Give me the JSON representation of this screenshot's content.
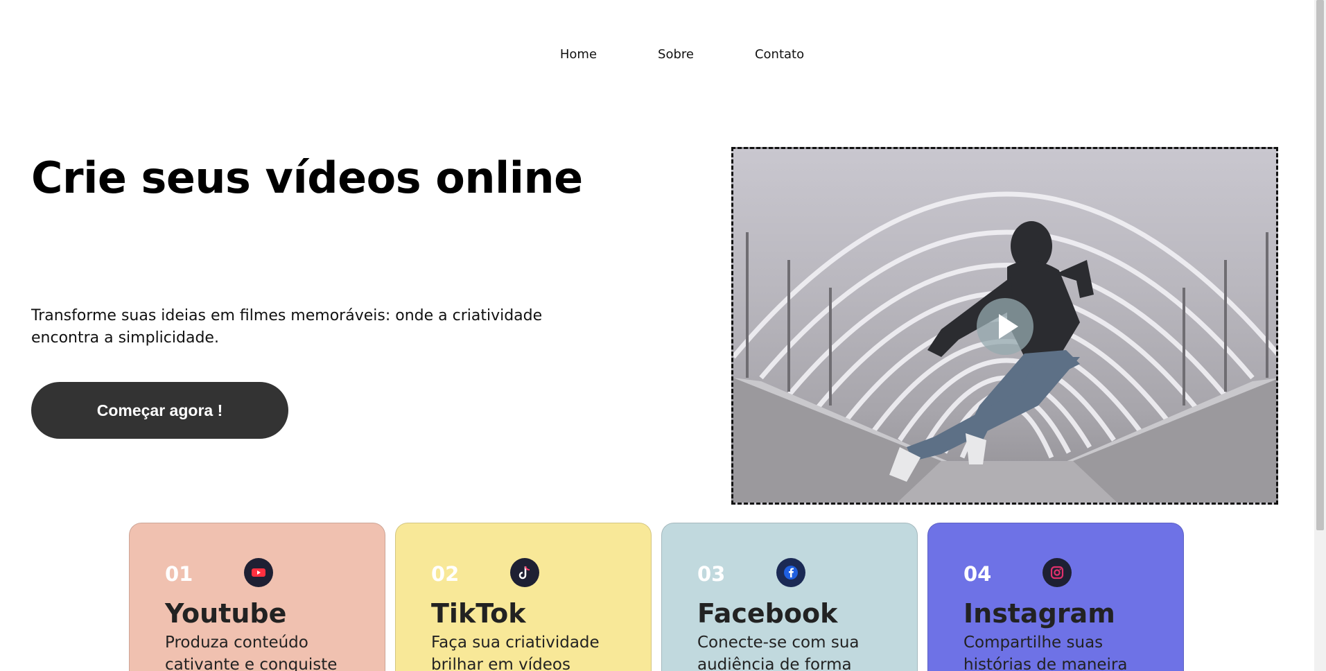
{
  "nav": {
    "items": [
      "Home",
      "Sobre",
      "Contato"
    ]
  },
  "hero": {
    "title": "Crie seus vídeos online",
    "subtitle": "Transforme suas ideias em filmes memoráveis: onde a criatividade encontra a simplicidade.",
    "cta_label": "Começar agora !"
  },
  "video": {
    "icon": "play-icon"
  },
  "cards": [
    {
      "num": "01",
      "name": "Youtube",
      "desc": "Produza conteúdo cativante e conquiste",
      "color": "#f0c1b0",
      "icon": "youtube-icon"
    },
    {
      "num": "02",
      "name": "TikTok",
      "desc": "Faça sua criatividade brilhar em vídeos",
      "color": "#f8e898",
      "icon": "tiktok-icon"
    },
    {
      "num": "03",
      "name": "Facebook",
      "desc": "Conecte-se com sua audiência de forma",
      "color": "#c1d9de",
      "icon": "facebook-icon"
    },
    {
      "num": "04",
      "name": "Instagram",
      "desc": "Compartilhe suas histórias de maneira",
      "color": "#6e72e6",
      "icon": "instagram-icon"
    }
  ]
}
